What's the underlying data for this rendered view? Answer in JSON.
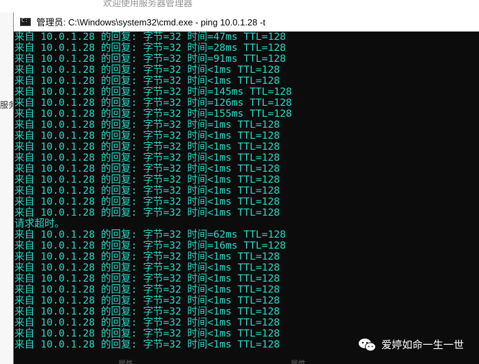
{
  "background": {
    "window_title": "欢迎使用服务器管理器",
    "sidebar_text": "服务",
    "bottom_left": "属性",
    "bottom_right": "属性"
  },
  "window": {
    "icon": "cmd-icon",
    "title": "管理员: C:\\Windows\\system32\\cmd.exe - ping  10.0.1.28 -t"
  },
  "console": {
    "lines": [
      "来自 10.0.1.28 的回复: 字节=32 时间=47ms TTL=128",
      "来自 10.0.1.28 的回复: 字节=32 时间=28ms TTL=128",
      "来自 10.0.1.28 的回复: 字节=32 时间=91ms TTL=128",
      "来自 10.0.1.28 的回复: 字节=32 时间<1ms TTL=128",
      "来自 10.0.1.28 的回复: 字节=32 时间<1ms TTL=128",
      "来自 10.0.1.28 的回复: 字节=32 时间=145ms TTL=128",
      "来自 10.0.1.28 的回复: 字节=32 时间=126ms TTL=128",
      "来自 10.0.1.28 的回复: 字节=32 时间=155ms TTL=128",
      "来自 10.0.1.28 的回复: 字节=32 时间=1ms TTL=128",
      "来自 10.0.1.28 的回复: 字节=32 时间<1ms TTL=128",
      "来自 10.0.1.28 的回复: 字节=32 时间<1ms TTL=128",
      "来自 10.0.1.28 的回复: 字节=32 时间<1ms TTL=128",
      "来自 10.0.1.28 的回复: 字节=32 时间<1ms TTL=128",
      "来自 10.0.1.28 的回复: 字节=32 时间<1ms TTL=128",
      "来自 10.0.1.28 的回复: 字节=32 时间<1ms TTL=128",
      "来自 10.0.1.28 的回复: 字节=32 时间<1ms TTL=128",
      "来自 10.0.1.28 的回复: 字节=32 时间<1ms TTL=128",
      "请求超时。",
      "来自 10.0.1.28 的回复: 字节=32 时间=62ms TTL=128",
      "来自 10.0.1.28 的回复: 字节=32 时间=16ms TTL=128",
      "来自 10.0.1.28 的回复: 字节=32 时间<1ms TTL=128",
      "来自 10.0.1.28 的回复: 字节=32 时间<1ms TTL=128",
      "来自 10.0.1.28 的回复: 字节=32 时间<1ms TTL=128",
      "来自 10.0.1.28 的回复: 字节=32 时间<1ms TTL=128",
      "来自 10.0.1.28 的回复: 字节=32 时间<1ms TTL=128",
      "来自 10.0.1.28 的回复: 字节=32 时间<1ms TTL=128",
      "来自 10.0.1.28 的回复: 字节=32 时间<1ms TTL=128",
      "来自 10.0.1.28 的回复: 字节=32 时间<1ms TTL=128",
      "来自 10.0.1.28 的回复: 字节=32 时间<1ms TTL=128"
    ]
  },
  "watermark": {
    "icon": "wechat-icon",
    "text": "爱婷如命一生一世"
  },
  "colors": {
    "console_text": "#2bd9c8",
    "console_bg": "#0c0c0c",
    "title_bar": "#ffffff"
  }
}
